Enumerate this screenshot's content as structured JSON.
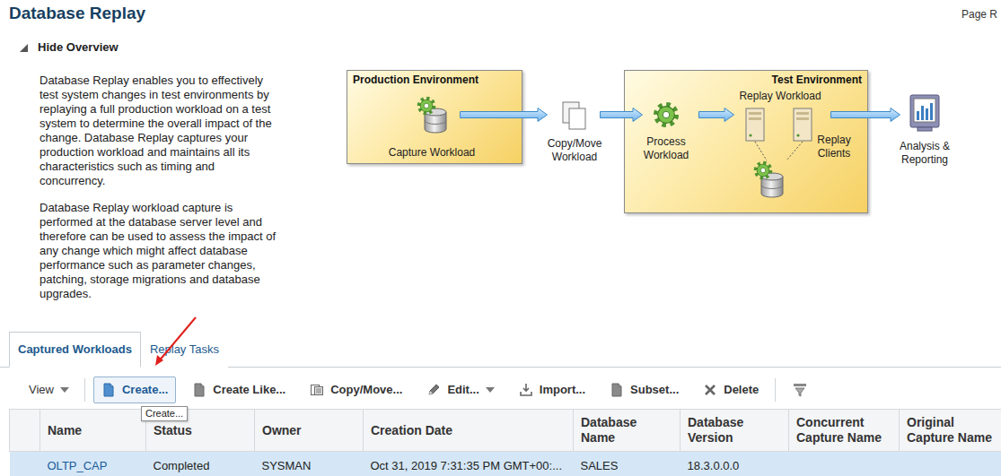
{
  "page": {
    "title": "Database Replay",
    "corner_text": "Page R"
  },
  "overview": {
    "toggle_label": "Hide Overview",
    "expanded": true,
    "paragraphs": [
      "Database Replay enables you to effectively test system changes in test environments by replaying a full production workload on a test system to determine the overall impact of the change. Database Replay captures your production workload and maintains all its characteristics such as timing and concurrency.",
      "Database Replay workload capture is performed at the database server level and therefore can be used to assess the impact of any change which might affect database performance such as parameter changes, patching, storage migrations and database upgrades."
    ]
  },
  "diagram": {
    "production": {
      "title": "Production Environment",
      "step": "Capture Workload"
    },
    "copy_step": "Copy/Move Workload",
    "test": {
      "title": "Test Environment",
      "process_step": "Process Workload",
      "replay_step": "Replay Workload",
      "clients": "Replay Clients"
    },
    "analysis_step": "Analysis & Reporting"
  },
  "tabs": [
    {
      "label": "Captured Workloads",
      "selected": true
    },
    {
      "label": "Replay Tasks",
      "selected": false
    }
  ],
  "toolbar": [
    {
      "label": "View",
      "kind": "view",
      "dropdown": true,
      "hovered": false
    },
    {
      "label": "Create...",
      "kind": "create",
      "dropdown": false,
      "hovered": true
    },
    {
      "label": "Create Like...",
      "kind": "create-like",
      "dropdown": false,
      "hovered": false
    },
    {
      "label": "Copy/Move...",
      "kind": "copy-move",
      "dropdown": false,
      "hovered": false
    },
    {
      "label": "Edit...",
      "kind": "edit",
      "dropdown": true,
      "hovered": false
    },
    {
      "label": "Import...",
      "kind": "import",
      "dropdown": false,
      "hovered": false
    },
    {
      "label": "Subset...",
      "kind": "subset",
      "dropdown": false,
      "hovered": false
    },
    {
      "label": "Delete",
      "kind": "delete",
      "dropdown": false,
      "hovered": false
    }
  ],
  "tooltip": {
    "text": "Create..."
  },
  "table": {
    "columns": [
      {
        "label": "Name",
        "kind": "link"
      },
      {
        "label": "Status",
        "kind": "text"
      },
      {
        "label": "Owner",
        "kind": "text"
      },
      {
        "label": "Creation Date",
        "kind": "text"
      },
      {
        "label": "Database Name",
        "kind": "text"
      },
      {
        "label": "Database Version",
        "kind": "text"
      },
      {
        "label": "Concurrent Capture Name",
        "kind": "text"
      },
      {
        "label": "Original Capture Name",
        "kind": "text"
      }
    ],
    "rows": [
      {
        "selected": true,
        "cells": [
          "OLTP_CAP",
          "Completed",
          "SYSMAN",
          "Oct 31, 2019 7:31:35 PM GMT+00:...",
          "SALES",
          "18.3.0.0.0",
          "",
          ""
        ]
      }
    ]
  }
}
